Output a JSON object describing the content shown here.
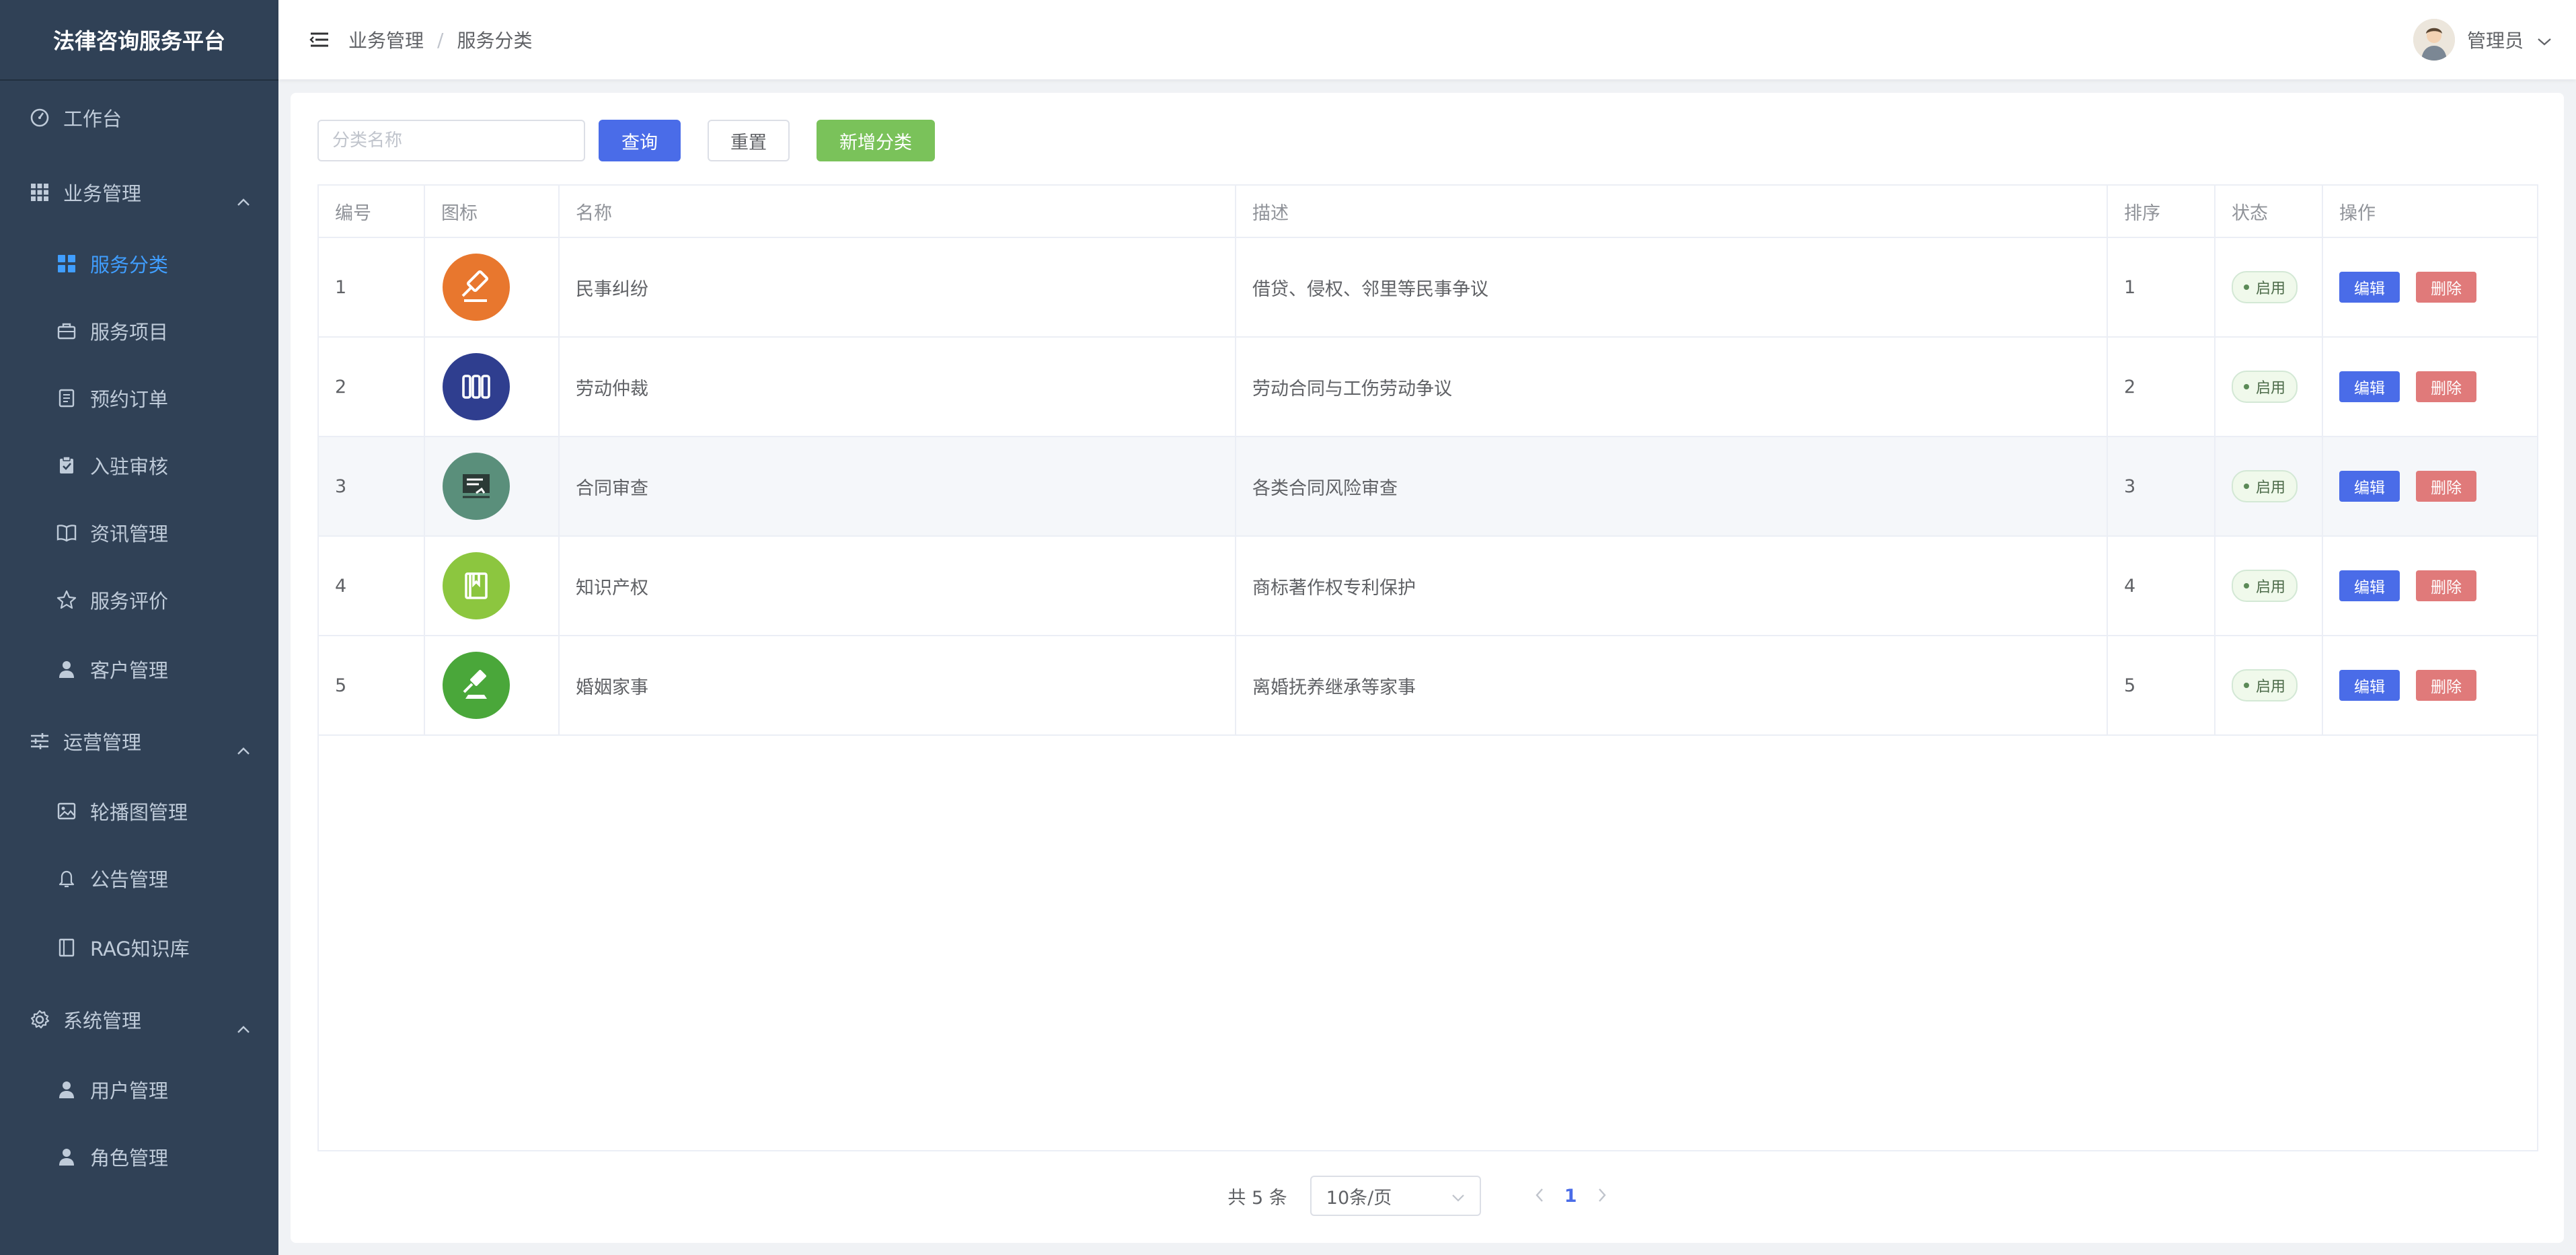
{
  "app": {
    "title": "法律咨询服务平台"
  },
  "sidebar": {
    "items": [
      {
        "label": "工作台",
        "icon": "dashboard-icon",
        "level": "top"
      },
      {
        "label": "业务管理",
        "icon": "grid-icon",
        "level": "group",
        "expanded": true
      },
      {
        "label": "服务分类",
        "icon": "category-icon",
        "level": "sub",
        "active": true
      },
      {
        "label": "服务项目",
        "icon": "briefcase-icon",
        "level": "sub"
      },
      {
        "label": "预约订单",
        "icon": "order-icon",
        "level": "sub"
      },
      {
        "label": "入驻审核",
        "icon": "clipboard-check-icon",
        "level": "sub"
      },
      {
        "label": "资讯管理",
        "icon": "book-icon",
        "level": "sub"
      },
      {
        "label": "服务评价",
        "icon": "star-icon",
        "level": "sub"
      },
      {
        "label": "客户管理",
        "icon": "user-icon",
        "level": "sub"
      },
      {
        "label": "运营管理",
        "icon": "sliders-icon",
        "level": "group",
        "expanded": true
      },
      {
        "label": "轮播图管理",
        "icon": "image-icon",
        "level": "sub"
      },
      {
        "label": "公告管理",
        "icon": "bell-icon",
        "level": "sub"
      },
      {
        "label": "RAG知识库",
        "icon": "notebook-icon",
        "level": "sub"
      },
      {
        "label": "系统管理",
        "icon": "gear-icon",
        "level": "group",
        "expanded": true
      },
      {
        "label": "用户管理",
        "icon": "user-icon",
        "level": "sub"
      },
      {
        "label": "角色管理",
        "icon": "user-role-icon",
        "level": "sub"
      }
    ],
    "active_color": "#409eff"
  },
  "header": {
    "breadcrumb": [
      "业务管理",
      "服务分类"
    ],
    "user_name": "管理员"
  },
  "search": {
    "placeholder": "分类名称",
    "value": "",
    "query_label": "查询",
    "reset_label": "重置",
    "add_label": "新增分类"
  },
  "table": {
    "columns": [
      "编号",
      "图标",
      "名称",
      "描述",
      "排序",
      "状态",
      "操作"
    ],
    "rows": [
      {
        "id": "1",
        "icon": "gavel-icon",
        "icon_color": "#e8772e",
        "name": "民事纠纷",
        "desc": "借贷、侵权、邻里等民事争议",
        "sort": "1",
        "status": "启用"
      },
      {
        "id": "2",
        "icon": "books-icon",
        "icon_color": "#2f3e8f",
        "name": "劳动仲裁",
        "desc": "劳动合同与工伤劳动争议",
        "sort": "2",
        "status": "启用"
      },
      {
        "id": "3",
        "icon": "contract-icon",
        "icon_color": "#5a8f7b",
        "name": "合同审查",
        "desc": "各类合同风险审查",
        "sort": "3",
        "status": "启用"
      },
      {
        "id": "4",
        "icon": "ip-book-icon",
        "icon_color": "#8cc63f",
        "name": "知识产权",
        "desc": "商标著作权专利保护",
        "sort": "4",
        "status": "启用"
      },
      {
        "id": "5",
        "icon": "gavel-icon",
        "icon_color": "#4aa73a",
        "name": "婚姻家事",
        "desc": "离婚抚养继承等家事",
        "sort": "5",
        "status": "启用"
      }
    ],
    "edit_label": "编辑",
    "delete_label": "删除",
    "highlighted_row": 3
  },
  "pagination": {
    "total_text": "共 5 条",
    "page_size": "10条/页",
    "current_page": "1"
  }
}
